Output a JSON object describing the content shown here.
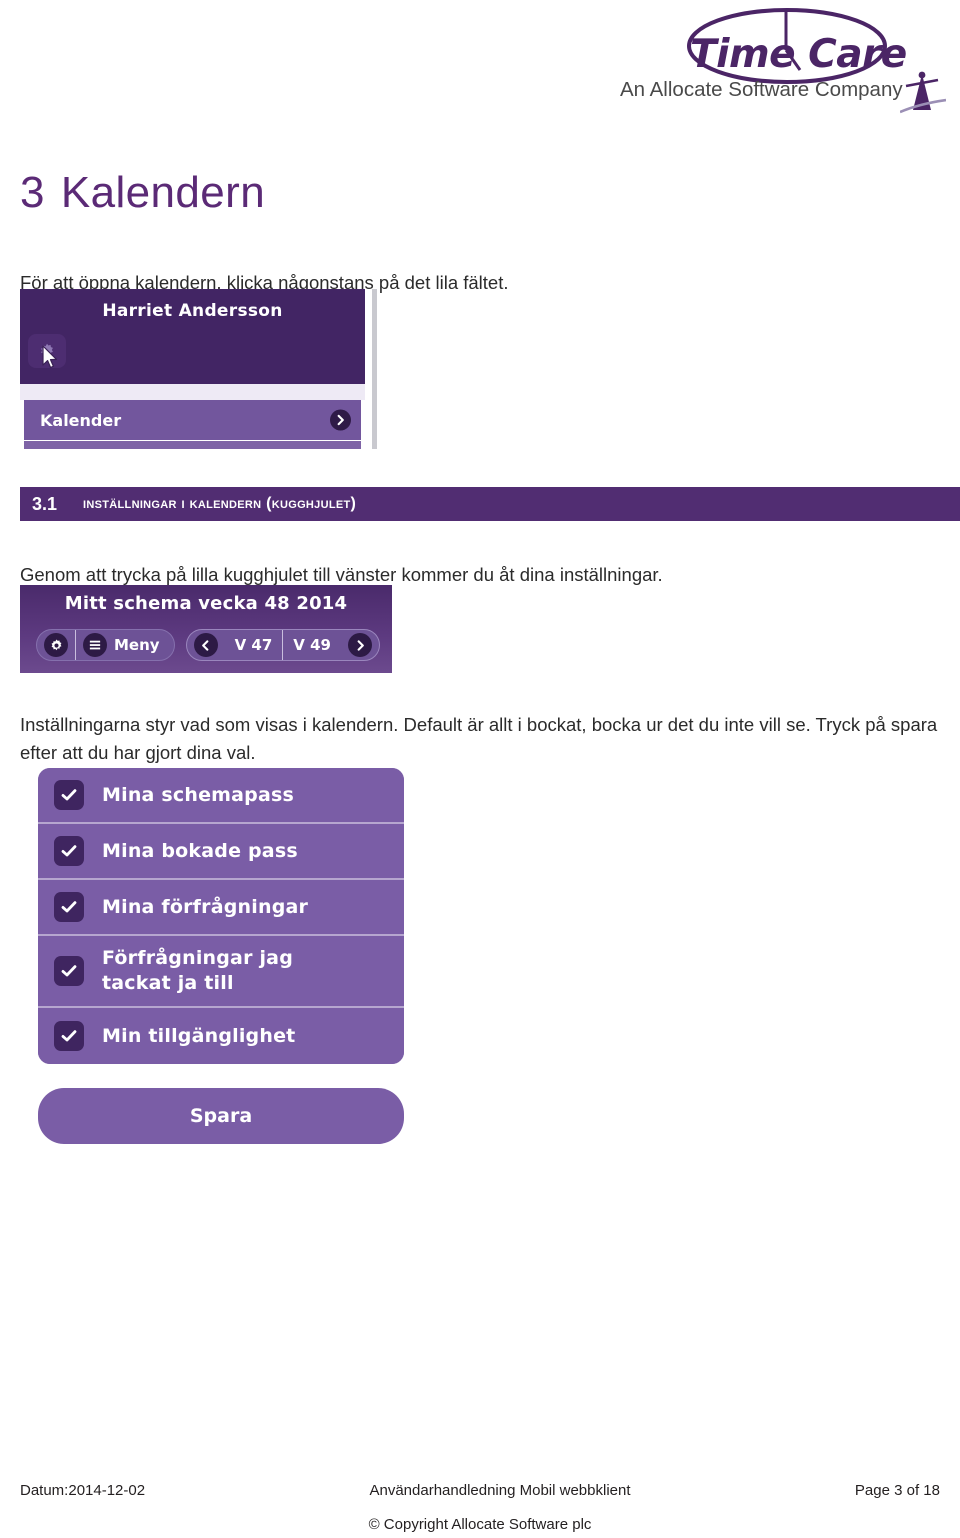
{
  "logo": {
    "wordmark": "Time Care",
    "tagline": "An Allocate Software Company",
    "icon": "clock-circle-icon",
    "brand_color": "#4b2566"
  },
  "heading": {
    "number": "3",
    "title": "Kalendern"
  },
  "intro_paragraph": "För att öppna kalendern, klicka någonstans på det lila fältet.",
  "profile_screenshot": {
    "user_name": "Harriet Andersson",
    "gear_icon": "gear-icon",
    "cursor_icon": "mouse-cursor-icon",
    "row_label": "Kalender",
    "row_chevron": "chevron-right-icon",
    "header_color": "#422564",
    "row_color": "#72569d"
  },
  "section": {
    "number": "3.1",
    "title": "Inställningar i kalendern (kugghjulet)",
    "paragraph": "Genom att trycka på lilla kugghjulet till vänster kommer du åt dina inställningar."
  },
  "toolbar_screenshot": {
    "title": "Mitt schema vecka 48  2014",
    "gear_icon": "gear-icon",
    "menu_icon": "hamburger-menu-icon",
    "menu_label": "Meny",
    "prev_chevron": "chevron-left-icon",
    "prev_week": "V 47",
    "next_week": "V 49",
    "next_chevron": "chevron-right-icon"
  },
  "settings_paragraph": "Inställningarna styr vad som visas i kalendern. Default är allt i bockat, bocka ur det du inte  vill se. Tryck på spara efter att du har gjort dina val.",
  "settings_screenshot": {
    "checkbox_icon": "checkmark-icon",
    "items": [
      {
        "label": "Mina schemapass",
        "checked": true
      },
      {
        "label": "Mina bokade pass",
        "checked": true
      },
      {
        "label": "Mina förfrågningar",
        "checked": true
      },
      {
        "label": "Förfrågningar jag tackat ja till",
        "checked": true
      },
      {
        "label": "Min tillgänglighet",
        "checked": true
      }
    ],
    "save_label": "Spara",
    "panel_color": "#7a5da6",
    "check_box_color": "#3f2560"
  },
  "footer": {
    "date": "Datum:2014-12-02",
    "document_title": "Användarhandledning Mobil webbklient",
    "page": "Page 3 of 18",
    "copyright": "© Copyright Allocate Software plc"
  }
}
